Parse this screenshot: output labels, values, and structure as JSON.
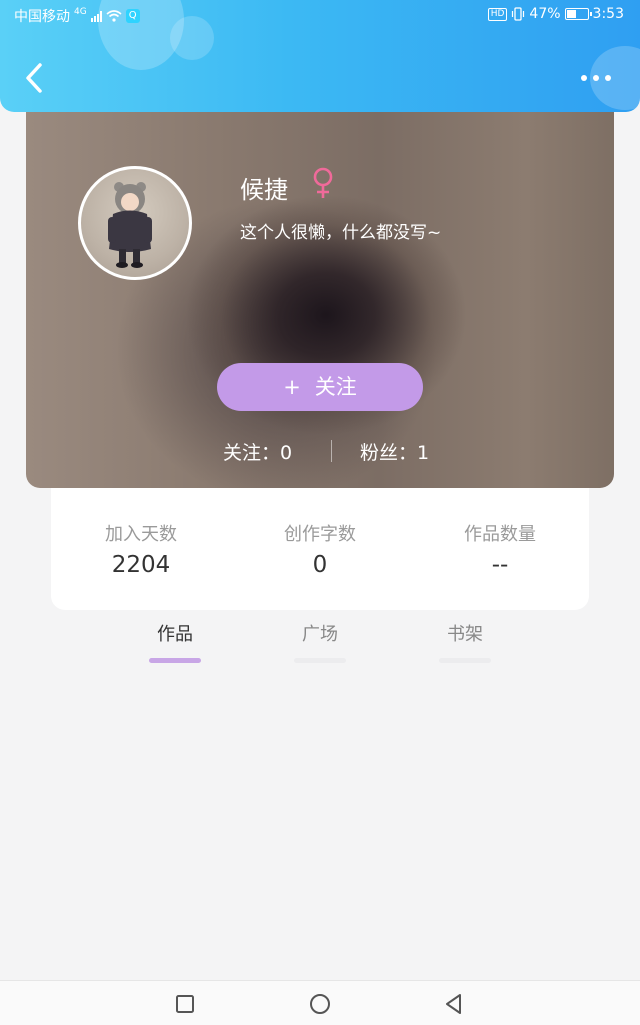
{
  "status_bar": {
    "carrier": "中国移动",
    "network": "4G",
    "battery": "47%",
    "battery_level": 0.47,
    "time": "3:53",
    "icons": [
      "signal-icon",
      "wifi-icon",
      "q-app-icon",
      "hd-icon",
      "vibrate-icon",
      "battery-icon"
    ]
  },
  "header": {
    "back_icon": "chevron-left-icon",
    "more_icon": "more-dots-icon"
  },
  "profile": {
    "username": "候捷",
    "gender_icon": "female-symbol-icon",
    "bio": "这个人很懒，什么都没写~",
    "follow_plus": "+",
    "follow_label": "关注",
    "following_text": "关注：0",
    "fans_text": "粉丝：1"
  },
  "stats": [
    {
      "label": "加入天数",
      "value": "2204"
    },
    {
      "label": "创作字数",
      "value": "0"
    },
    {
      "label": "作品数量",
      "value": "--"
    }
  ],
  "tabs": [
    {
      "label": "作品",
      "active": true
    },
    {
      "label": "广场",
      "active": false
    },
    {
      "label": "书架",
      "active": false
    }
  ],
  "colors": {
    "header_start": "#5ad0f7",
    "header_end": "#2f9ff2",
    "accent_purple": "#c39ae8",
    "tab_indicator": "#c8a6e6",
    "gender_pink": "#f06a9a"
  },
  "navbar": {
    "icons": [
      "recent-apps-square-icon",
      "home-circle-icon",
      "back-triangle-icon"
    ]
  }
}
